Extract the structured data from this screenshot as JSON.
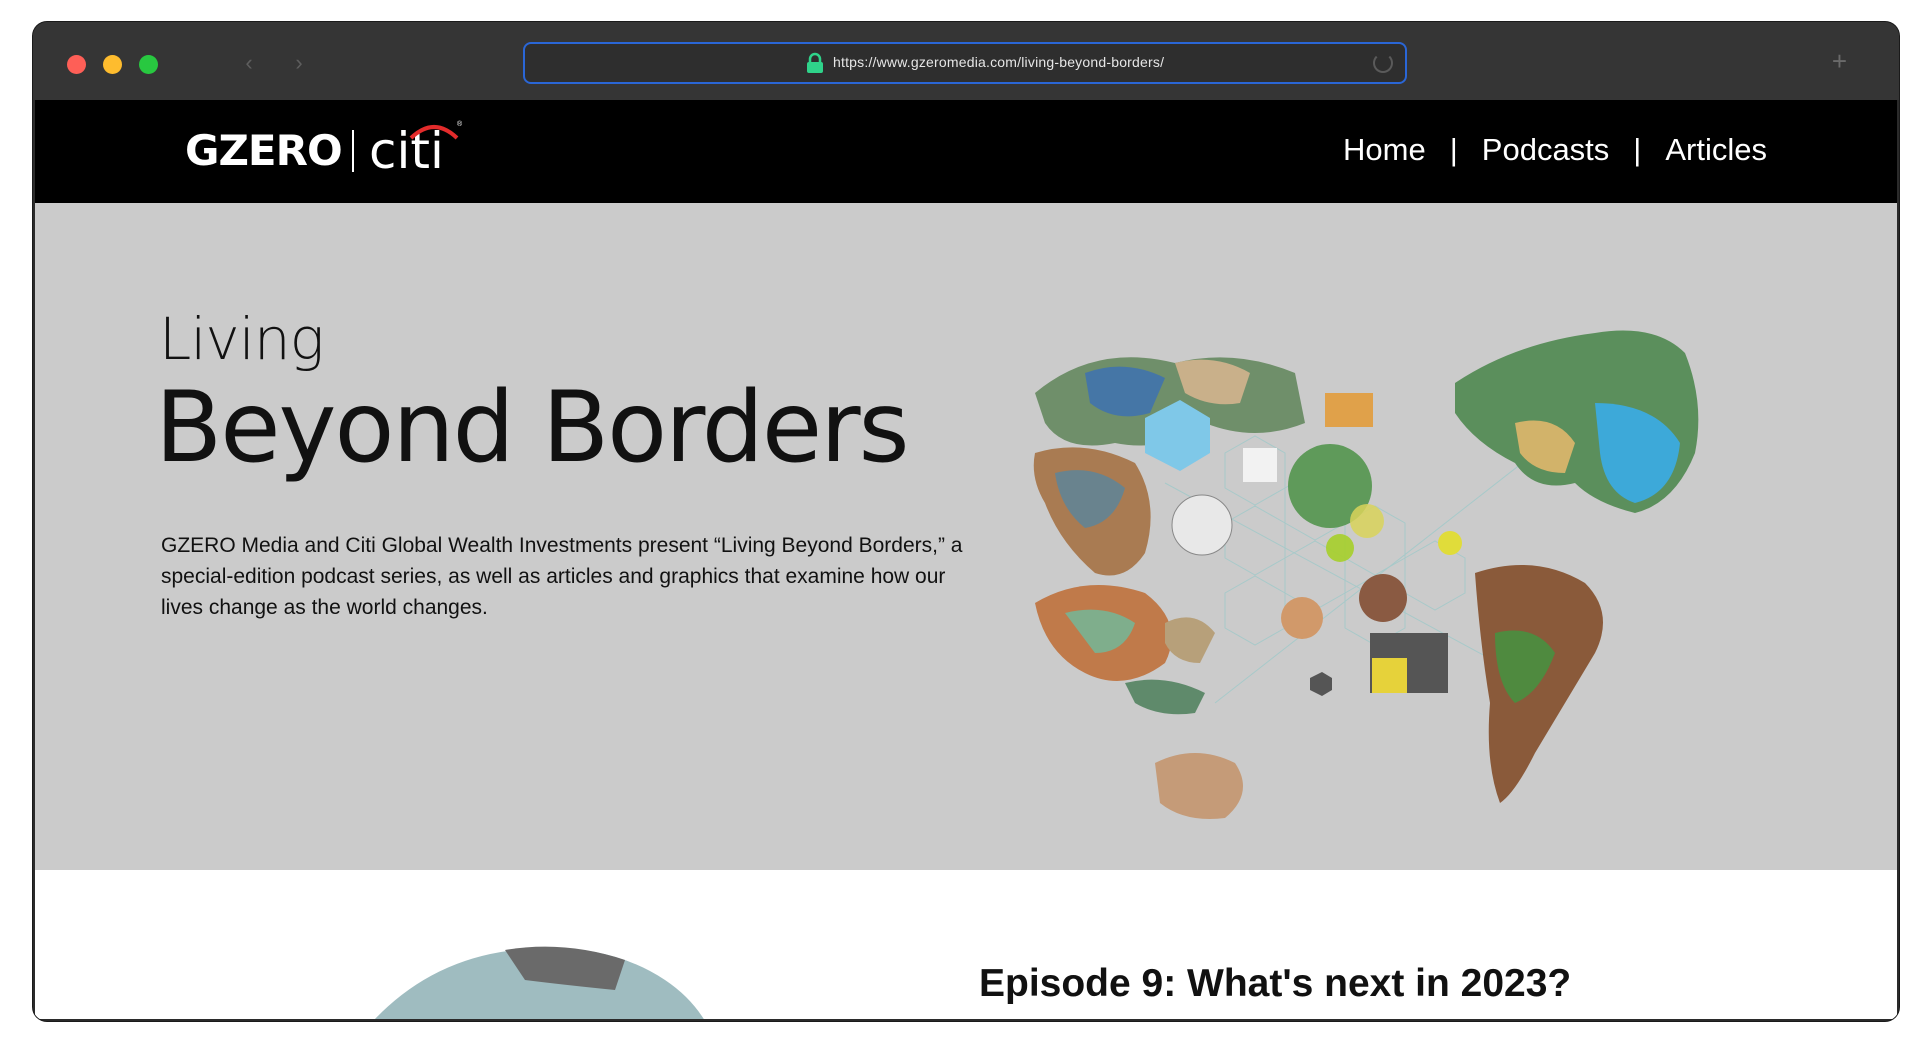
{
  "browser": {
    "url": "https://www.gzeromedia.com/living-beyond-borders/",
    "icons": [
      "lock-icon",
      "reload-icon",
      "new-tab-icon",
      "back-icon",
      "forward-icon"
    ]
  },
  "site": {
    "logo_gzero": "GZERO",
    "logo_citi": "citi",
    "nav": [
      {
        "label": "Home"
      },
      {
        "label": "Podcasts"
      },
      {
        "label": "Articles"
      }
    ],
    "nav_separator": "|"
  },
  "hero": {
    "title_line1": "Living",
    "title_line2": "Beyond Borders",
    "description": "GZERO Media and Citi Global Wealth Investments present “Living Beyond Borders,” a special-edition podcast series, as well as articles and graphics that examine how our lives change as the world changes."
  },
  "episode": {
    "title": "Episode 9: What's next in 2023?"
  },
  "colors": {
    "header_bg": "#000000",
    "hero_bg": "#cbcbcb",
    "address_border": "#2a66d6",
    "lock": "#2fd38a"
  }
}
